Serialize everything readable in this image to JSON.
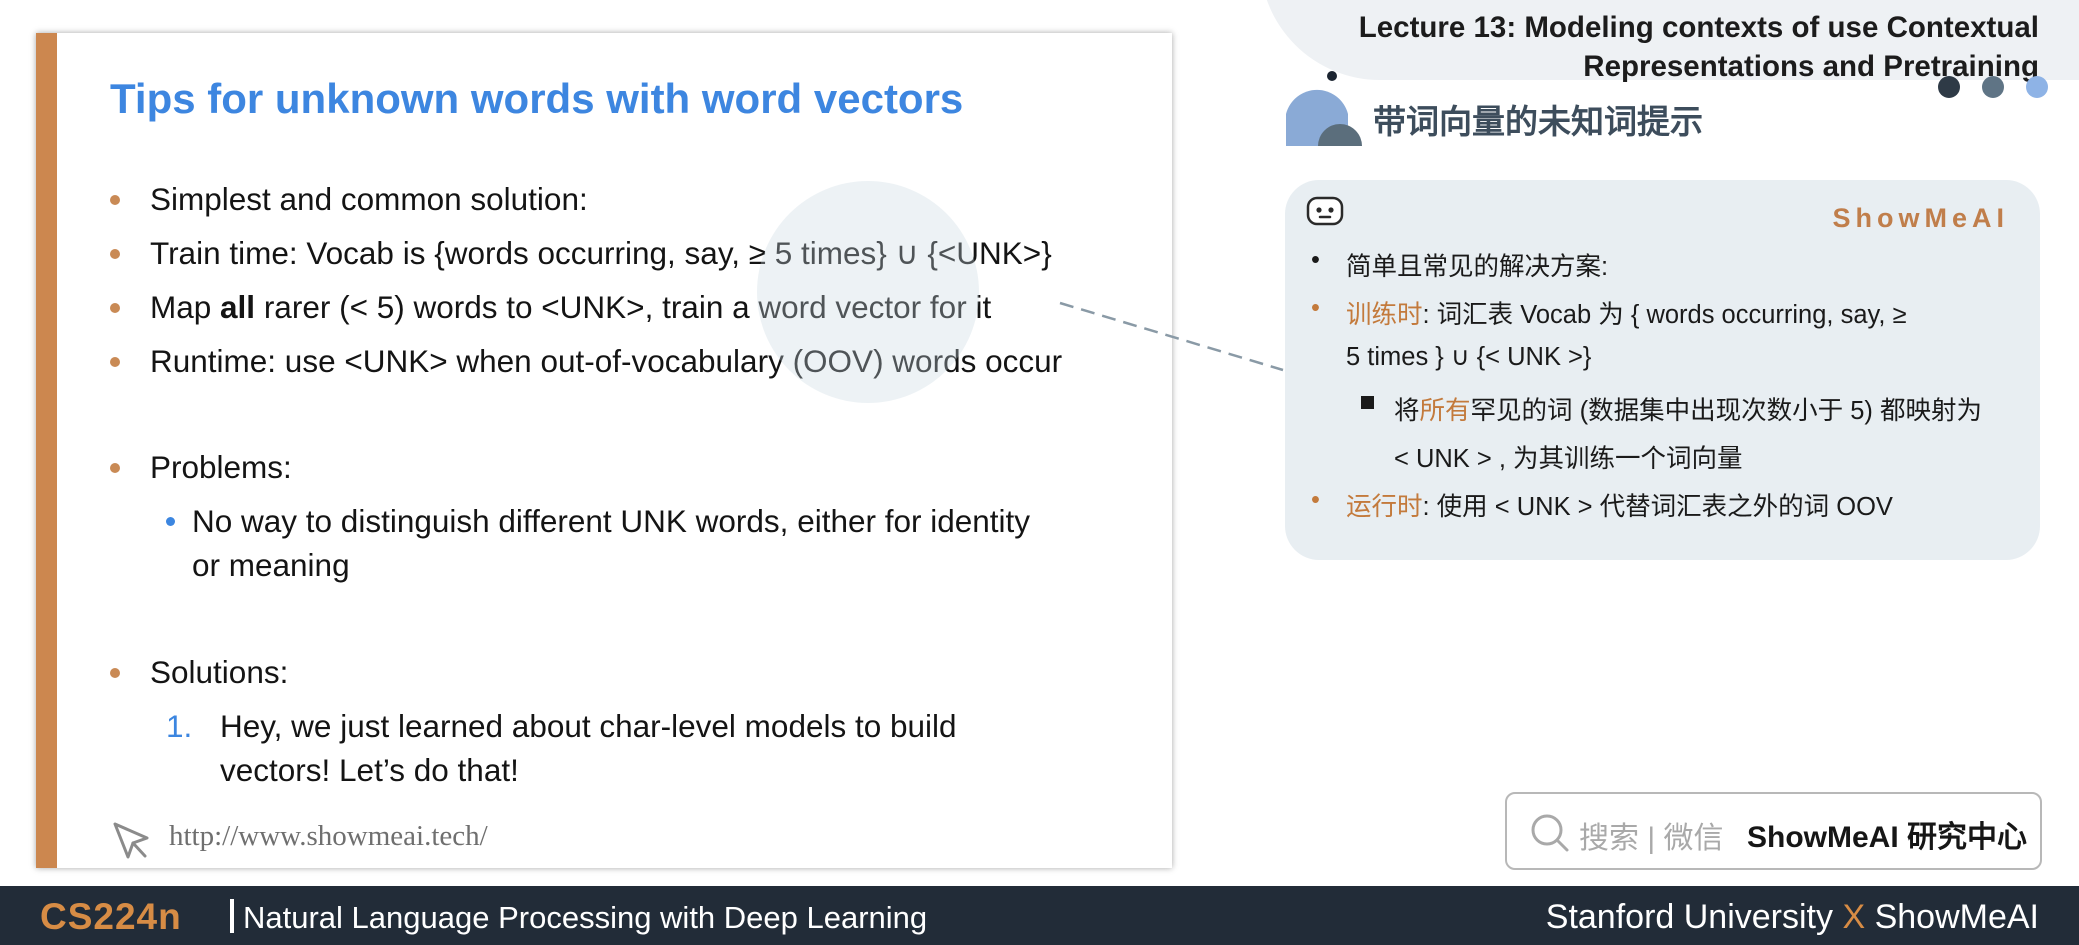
{
  "slide": {
    "title": "Tips for unknown words with word vectors",
    "bullets": [
      {
        "text": "Simplest and common solution:"
      },
      {
        "text": "Train time: Vocab is {words occurring, say, ≥ 5 times} ∪ {<UNK>}"
      },
      {
        "pre": "Map ",
        "bold": "all",
        "post": " rarer (< 5) words to <UNK>, train a word vector for it"
      },
      {
        "text": "Runtime: use <UNK> when out-of-vocabulary (OOV) words occur"
      }
    ],
    "problems_heading": "Problems:",
    "problem_items": [
      "No way to distinguish different UNK words, either for identity",
      "or meaning"
    ],
    "solutions_heading": "Solutions:",
    "solution_number": "1.",
    "solution_items": [
      "Hey, we just learned about char-level models to build",
      "vectors! Let’s do that!"
    ],
    "url": "http://www.showmeai.tech/"
  },
  "lecture": {
    "line1": "Lecture 13:  Modeling contexts of use Contextual",
    "line2": "Representations and Pretraining"
  },
  "section_title": "带词向量的未知词提示",
  "card": {
    "brand": "ShowMeAI",
    "b1": "简单且常见的解决方案:",
    "b2_label": "训练时",
    "b2_text": ": 词汇表   Vocab   为  { words occurring, say, ≥",
    "b2_cont": "5 times } ∪ {< UNK >}",
    "b3_pre": "将",
    "b3_highlight": "所有",
    "b3_text": "罕见的词 (数据集中出现次数小于 5) 都映射为",
    "b3_cont": "< UNK > , 为其训练一个词向量",
    "b4_label": "运行时",
    "b4_text": ": 使用 < UNK > 代替词汇表之外的词 OOV"
  },
  "search": {
    "hint": "搜索 | 微信",
    "brand": "ShowMeAI 研究中心"
  },
  "footer": {
    "course_code": "CS224n",
    "course_name": "Natural Language Processing with Deep Learning",
    "org_left": "Stanford University",
    "org_x": "X",
    "org_right": "ShowMeAI"
  },
  "colors": {
    "accent_orange": "#cc874f",
    "title_blue": "#3d86e0",
    "footer_bg": "#222c38"
  }
}
